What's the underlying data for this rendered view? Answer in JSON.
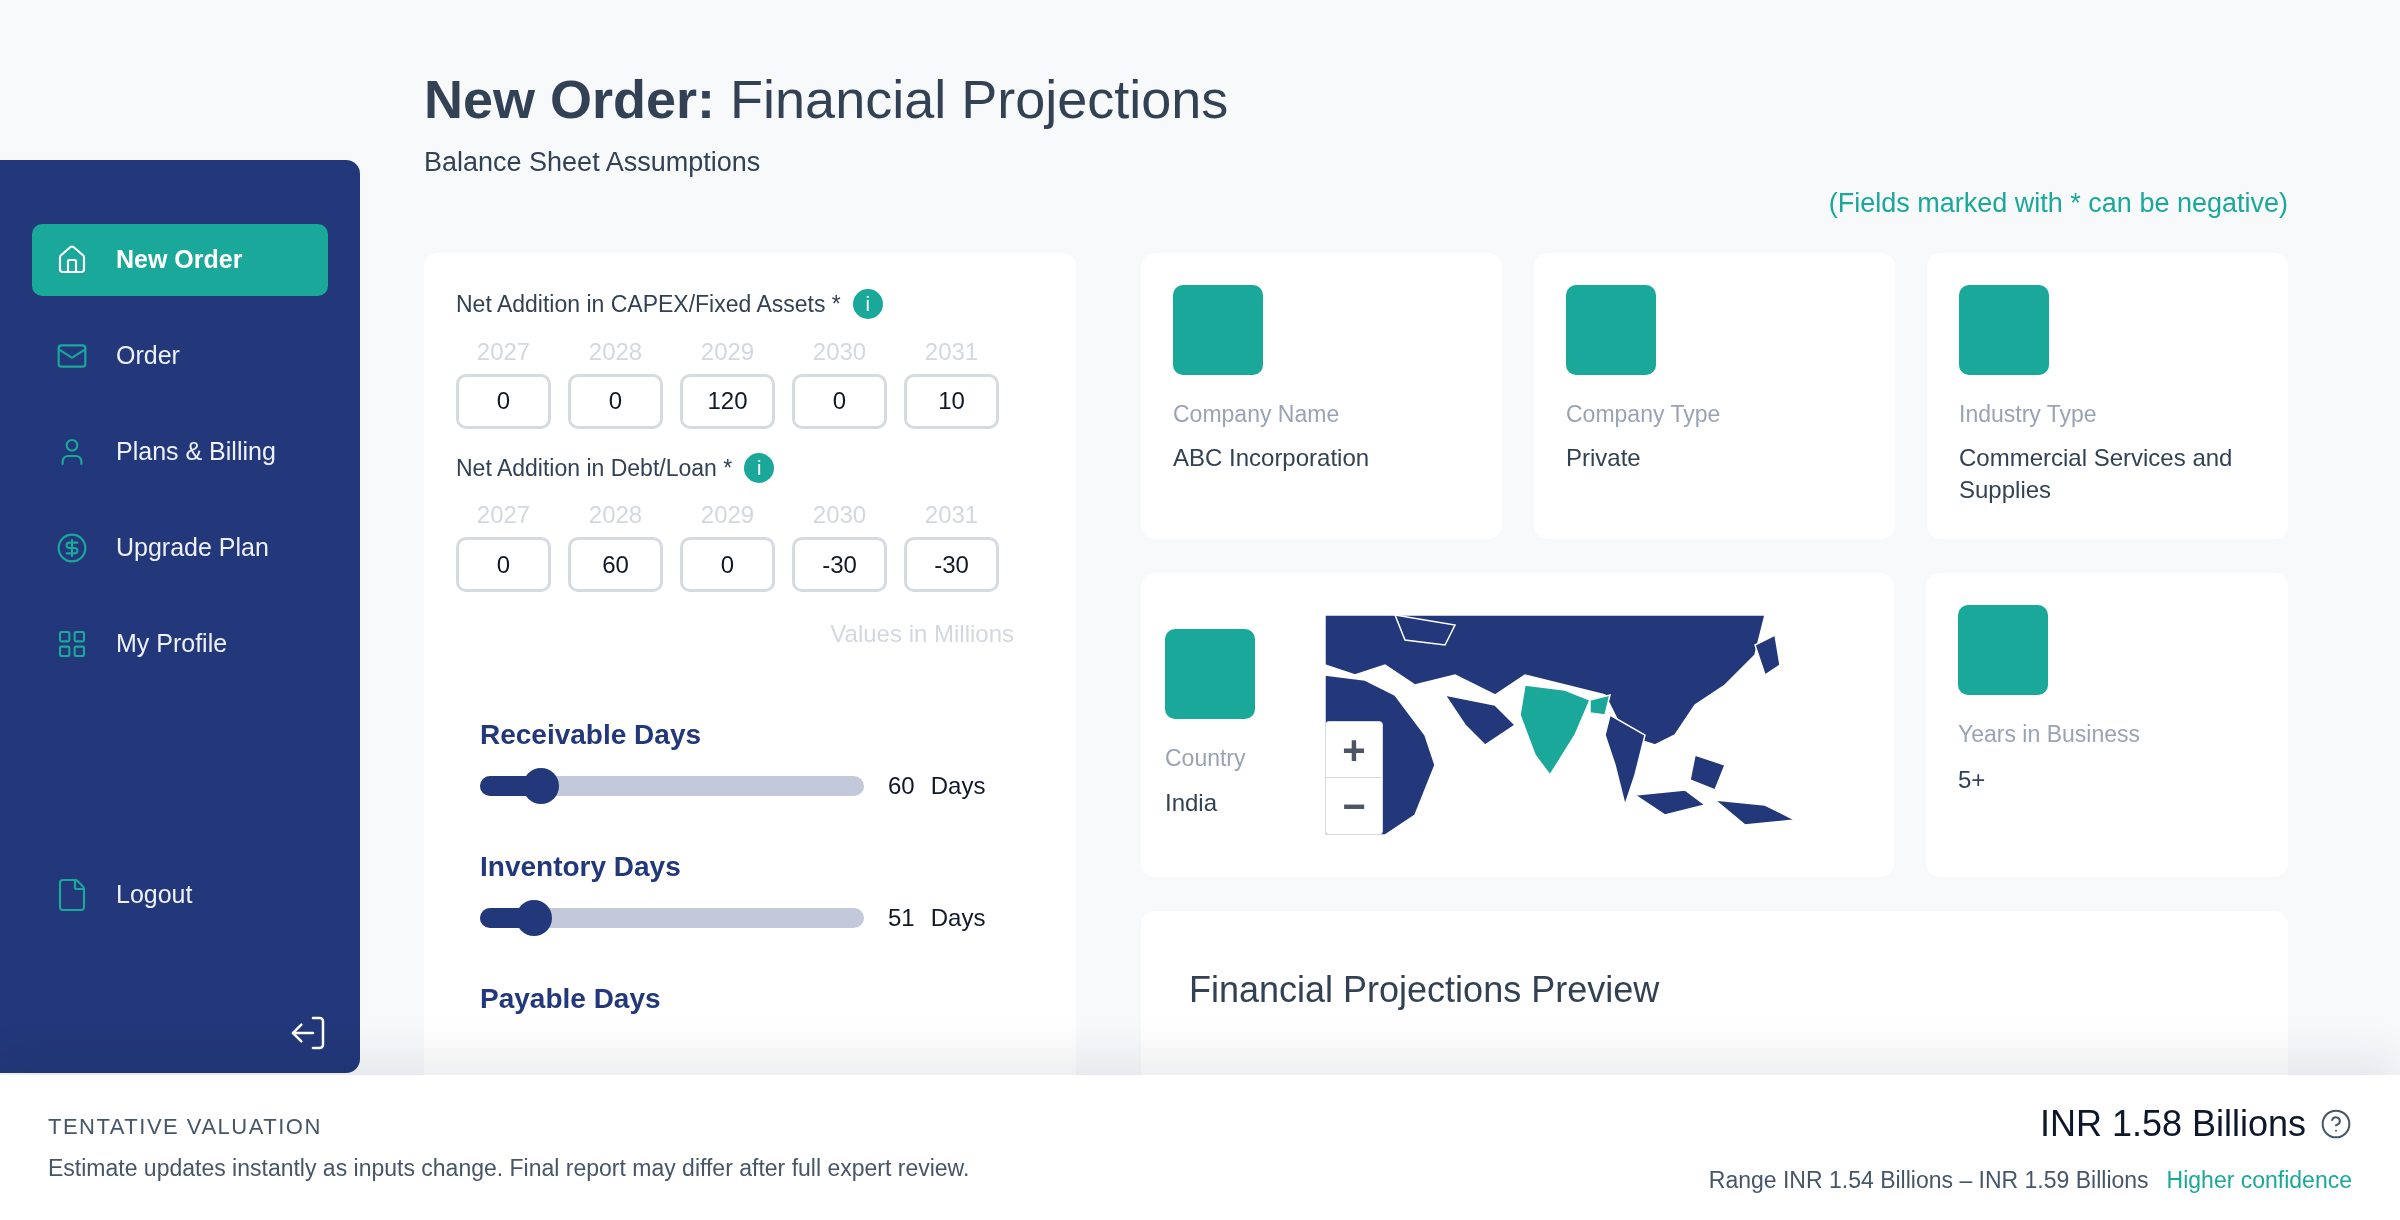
{
  "sidebar": {
    "items": [
      {
        "label": "New Order",
        "selected": true
      },
      {
        "label": "Order",
        "selected": false
      },
      {
        "label": "Plans & Billing",
        "selected": false
      },
      {
        "label": "Upgrade Plan",
        "selected": false
      },
      {
        "label": "My Profile",
        "selected": false
      }
    ],
    "logout": "Logout"
  },
  "header": {
    "title_bold": "New Order:",
    "title": "Financial Projections",
    "subtitle": "Balance Sheet Assumptions",
    "note": "(Fields marked with * can be negative)"
  },
  "assumptions": {
    "groups": [
      {
        "label": "Net Addition in CAPEX/Fixed Assets *",
        "info": "i",
        "years": [
          {
            "year": "2027",
            "value": "0"
          },
          {
            "year": "2028",
            "value": "0"
          },
          {
            "year": "2029",
            "value": "120"
          },
          {
            "year": "2030",
            "value": "0"
          },
          {
            "year": "2031",
            "value": "10"
          }
        ]
      },
      {
        "label": "Net Addition in Debt/Loan *",
        "info": "i",
        "years": [
          {
            "year": "2027",
            "value": "0"
          },
          {
            "year": "2028",
            "value": "60"
          },
          {
            "year": "2029",
            "value": "0"
          },
          {
            "year": "2030",
            "value": "-30"
          },
          {
            "year": "2031",
            "value": "-30"
          }
        ]
      }
    ],
    "unit_note": "Values in Millions",
    "sliders": [
      {
        "label": "Receivable Days",
        "level": 0.16,
        "value": "60",
        "unit": "Days"
      },
      {
        "label": "Inventory Days",
        "level": 0.14,
        "value": "51",
        "unit": "Days"
      }
    ],
    "cut_off_title": "Payable Days"
  },
  "info_cards": [
    {
      "label": "Company Name",
      "value": "ABC Incorporation"
    },
    {
      "label": "Company Type",
      "value": "Private"
    },
    {
      "label": "Industry Type",
      "value": "Commercial Services and Supplies"
    }
  ],
  "country_card": {
    "label": "Country",
    "value": "India",
    "map": {
      "zoom_in": "+",
      "zoom_out": "−"
    }
  },
  "years_card": {
    "label": "Years in Business",
    "value": "5+"
  },
  "preview": {
    "title": "Financial Projections Preview"
  },
  "valuation": {
    "heading": "TENTATIVE VALUATION",
    "description": "Estimate updates instantly as inputs change. Final report may differ after full expert review.",
    "amount": "INR 1.58 Billions",
    "range": "Range INR 1.54 Billions – INR 1.59 Billions",
    "confidence": "Higher confidence"
  }
}
